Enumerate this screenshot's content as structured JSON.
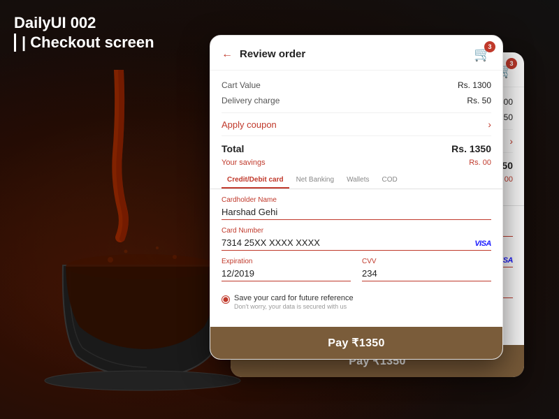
{
  "page": {
    "title_line1": "DailyUI 002",
    "title_line2": "| Checkout screen",
    "bg_color": "#1a1a1a"
  },
  "card": {
    "header": {
      "back_arrow": "←",
      "title": "Review order",
      "cart_badge": "3"
    },
    "order_summary": {
      "cart_value_label": "Cart Value",
      "cart_value": "Rs. 1300",
      "delivery_label": "Delivery charge",
      "delivery_value": "Rs. 50",
      "coupon_label": "Apply coupon",
      "coupon_arrow": "›",
      "total_label": "Total",
      "total_value": "Rs. 1350",
      "savings_label": "Your savings",
      "savings_value": "Rs. 00"
    },
    "tabs": [
      {
        "label": "Credit/Debit card",
        "active": true
      },
      {
        "label": "Net Banking",
        "active": false
      },
      {
        "label": "Wallets",
        "active": false
      },
      {
        "label": "COD",
        "active": false
      }
    ],
    "form": {
      "cardholder_label": "Cardholder Name",
      "cardholder_value": "Harshad Gehi",
      "card_number_label": "Card Number",
      "card_number_value": "7314 25XX XXXX XXXX",
      "card_brand": "VISA",
      "expiration_label": "Expiration",
      "expiration_value": "12/2019",
      "cvv_label": "CVV",
      "cvv_value": "234",
      "save_card_label": "Save your card for future reference",
      "save_card_sub": "Don't worry, your data is secured with us"
    },
    "pay_button": "Pay ₹1350"
  }
}
